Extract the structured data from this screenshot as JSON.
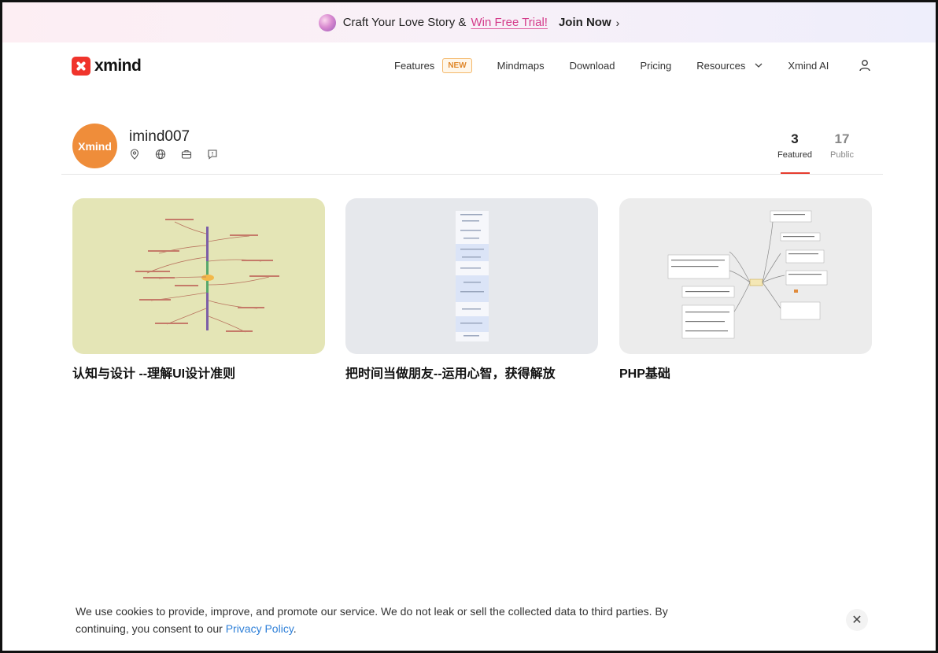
{
  "promo": {
    "text": "Craft Your Love Story &",
    "link": "Win Free Trial!",
    "cta": "Join Now",
    "chevron": "›",
    "icon": "gem-icon"
  },
  "brand": {
    "name": "xmind",
    "color": "#f0342c"
  },
  "nav": {
    "items": [
      {
        "label": "Features",
        "badge": "NEW"
      },
      {
        "label": "Mindmaps"
      },
      {
        "label": "Download"
      },
      {
        "label": "Pricing"
      },
      {
        "label": "Resources",
        "caret": "⌄"
      },
      {
        "label": "Xmind AI"
      }
    ]
  },
  "profile": {
    "avatar_text": "Xmind",
    "avatar_color": "#ef8d3a",
    "username": "imind007",
    "icons": [
      "location-icon",
      "globe-icon",
      "briefcase-icon",
      "comment-icon"
    ]
  },
  "stats": {
    "featured": {
      "count": "3",
      "label": "Featured"
    },
    "public": {
      "count": "17",
      "label": "Public"
    }
  },
  "cards": [
    {
      "title": "认知与设计 --理解UI设计准则",
      "bg": "#e4e5b6"
    },
    {
      "title": "把时间当做朋友--运用心智，获得解放",
      "bg": "#e6e8ec"
    },
    {
      "title": "PHP基础",
      "bg": "#ececec"
    }
  ],
  "cookie": {
    "text": "We use cookies to provide, improve, and promote our service. We do not leak or sell the collected data to third parties. By continuing, you consent to our",
    "link": "Privacy Policy",
    "end": ".",
    "close": "✕"
  }
}
